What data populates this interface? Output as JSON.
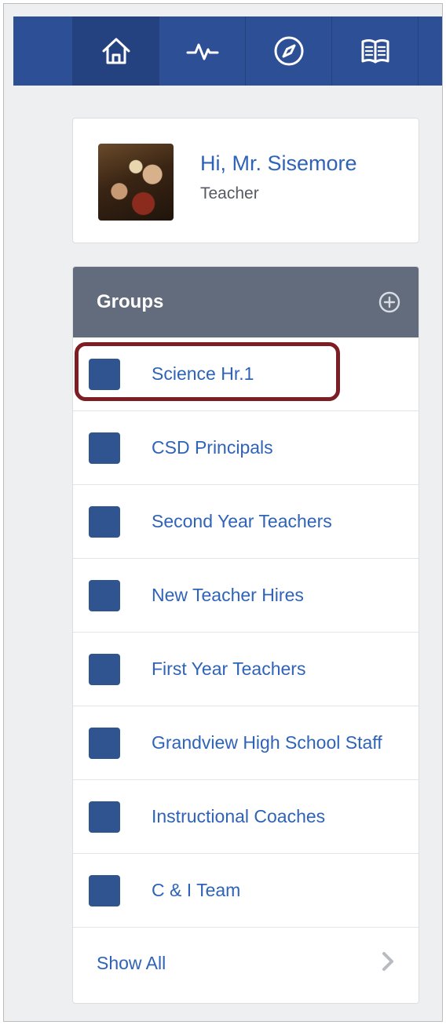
{
  "nav": {
    "tabs": [
      {
        "icon": "home-icon",
        "active": true
      },
      {
        "icon": "activity-icon",
        "active": false
      },
      {
        "icon": "compass-icon",
        "active": false
      },
      {
        "icon": "book-icon",
        "active": false
      }
    ]
  },
  "profile": {
    "greeting": "Hi, Mr. Sisemore",
    "role": "Teacher"
  },
  "groups": {
    "title": "Groups",
    "add_icon": "plus-circle-icon",
    "items": [
      {
        "label": "Science Hr.1"
      },
      {
        "label": "CSD Principals"
      },
      {
        "label": "Second Year Teachers"
      },
      {
        "label": "New Teacher Hires"
      },
      {
        "label": "First Year Teachers"
      },
      {
        "label": "Grandview High School Staff"
      },
      {
        "label": "Instructional Coaches"
      },
      {
        "label": "C & I Team"
      }
    ],
    "show_all": "Show All"
  },
  "colors": {
    "nav_bg": "#2d4f96",
    "header_bg": "#636c7d",
    "link": "#2f63b7",
    "swatch": "#2f548f",
    "highlight": "#7d1d24"
  }
}
